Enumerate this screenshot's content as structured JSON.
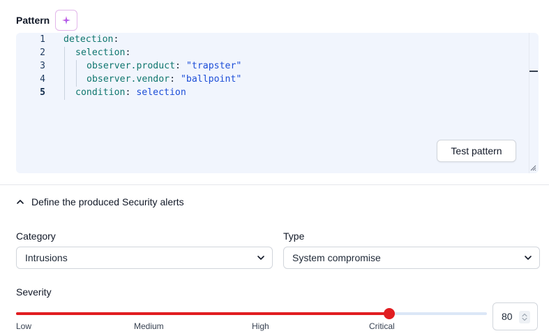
{
  "pattern": {
    "label": "Pattern",
    "ai_icon": "sparkle-icon",
    "lines": [
      {
        "num": "1",
        "key": "detection",
        "sep": ":",
        "value": ""
      },
      {
        "num": "2",
        "key": "selection",
        "sep": ":",
        "value": ""
      },
      {
        "num": "3",
        "key": "observer.product",
        "sep": ": ",
        "value": "\"trapster\""
      },
      {
        "num": "4",
        "key": "observer.vendor",
        "sep": ": ",
        "value": "\"ballpoint\""
      },
      {
        "num": "5",
        "key": "condition",
        "sep": ": ",
        "value": "selection"
      }
    ],
    "test_button": "Test pattern"
  },
  "alerts": {
    "section_title": "Define the produced Security alerts",
    "toggle_icon": "chevron-up-icon",
    "category": {
      "label": "Category",
      "value": "Intrusions"
    },
    "type": {
      "label": "Type",
      "value": "System compromise"
    },
    "severity": {
      "label": "Severity",
      "value": "80",
      "fraction": 0.8,
      "ticks": [
        "Low",
        "Medium",
        "High",
        "Critical"
      ]
    }
  },
  "colors": {
    "slider_active": "#e11d21",
    "slider_track": "#dbe7f7",
    "editor_bg": "#f1f5fd",
    "code_key": "#0f766e",
    "code_string": "#1d4ed8"
  }
}
